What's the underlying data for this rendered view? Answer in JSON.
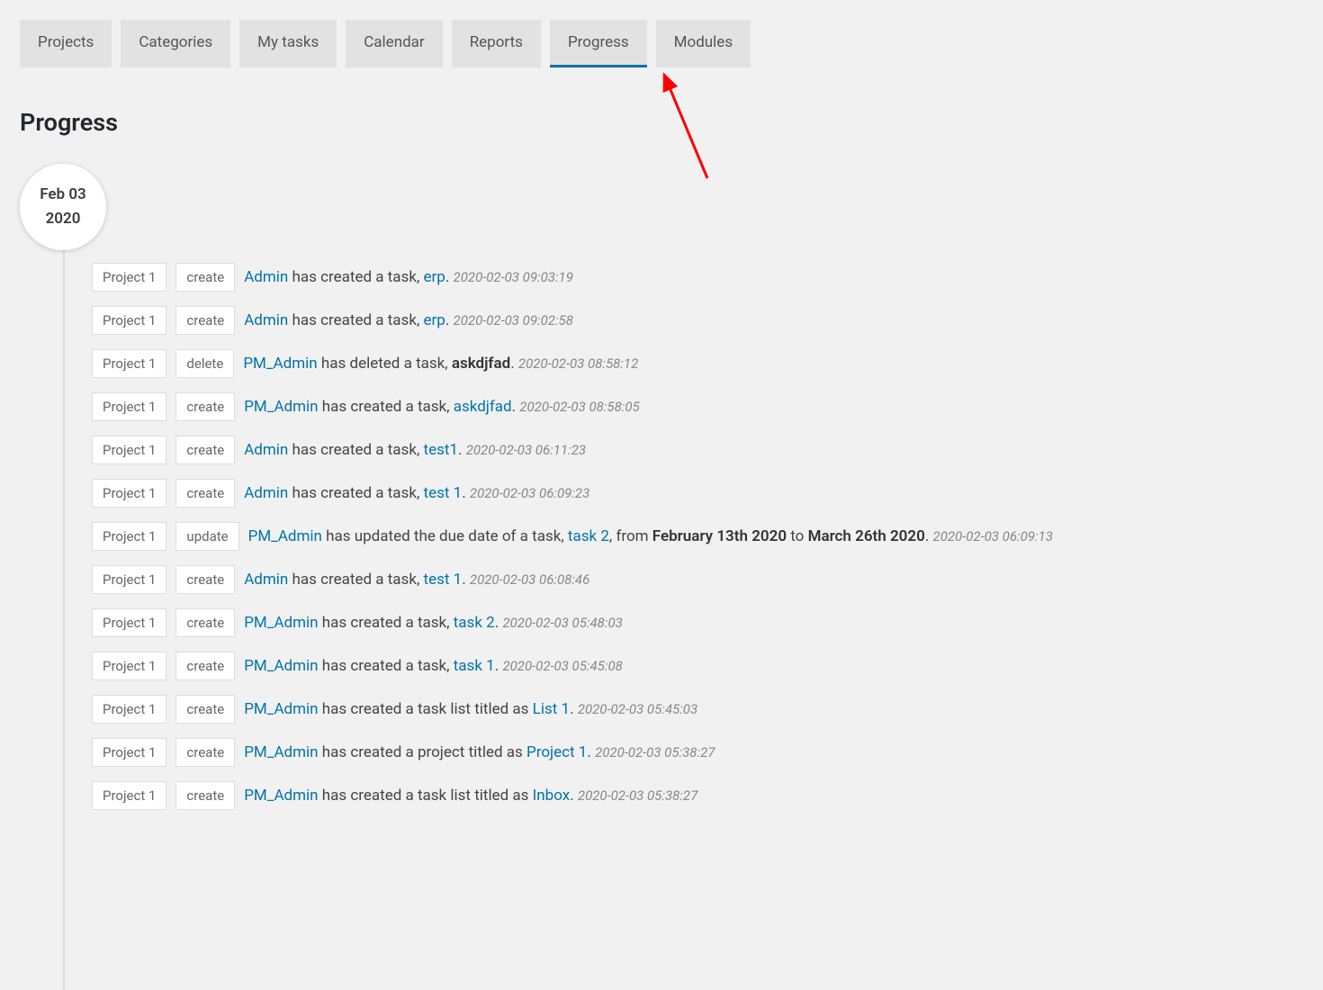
{
  "tabs": [
    {
      "label": "Projects",
      "active": false
    },
    {
      "label": "Categories",
      "active": false
    },
    {
      "label": "My tasks",
      "active": false
    },
    {
      "label": "Calendar",
      "active": false
    },
    {
      "label": "Reports",
      "active": false
    },
    {
      "label": "Progress",
      "active": true
    },
    {
      "label": "Modules",
      "active": false
    }
  ],
  "page_title": "Progress",
  "date_badge": {
    "line1": "Feb 03",
    "line2": "2020"
  },
  "activities": [
    {
      "project": "Project 1",
      "action": "create",
      "user": "Admin",
      "middle": "has created a task,",
      "object": "erp",
      "suffix": ".",
      "timestamp": "2020-02-03 09:03:19"
    },
    {
      "project": "Project 1",
      "action": "create",
      "user": "Admin",
      "middle": "has created a task,",
      "object": "erp",
      "suffix": ".",
      "timestamp": "2020-02-03 09:02:58"
    },
    {
      "project": "Project 1",
      "action": "delete",
      "user": "PM_Admin",
      "middle": "has deleted a task,",
      "object_bold": "askdjfad",
      "suffix": ".",
      "timestamp": "2020-02-03 08:58:12"
    },
    {
      "project": "Project 1",
      "action": "create",
      "user": "PM_Admin",
      "middle": "has created a task,",
      "object": "askdjfad",
      "suffix": ".",
      "timestamp": "2020-02-03 08:58:05"
    },
    {
      "project": "Project 1",
      "action": "create",
      "user": "Admin",
      "middle": "has created a task,",
      "object": "test1",
      "suffix": ".",
      "timestamp": "2020-02-03 06:11:23"
    },
    {
      "project": "Project 1",
      "action": "create",
      "user": "Admin",
      "middle": "has created a task,",
      "object": "test 1",
      "suffix": ".",
      "timestamp": "2020-02-03 06:09:23"
    },
    {
      "project": "Project 1",
      "action": "update",
      "user": "PM_Admin",
      "middle": "has updated the due date of a task,",
      "object": "task 2",
      "suffix": ", from ",
      "bold1": "February 13th 2020",
      "mid2": " to ",
      "bold2": "March 26th 2020",
      "suffix2": ".",
      "timestamp": "2020-02-03 06:09:13"
    },
    {
      "project": "Project 1",
      "action": "create",
      "user": "Admin",
      "middle": "has created a task,",
      "object": "test 1",
      "suffix": ".",
      "timestamp": "2020-02-03 06:08:46"
    },
    {
      "project": "Project 1",
      "action": "create",
      "user": "PM_Admin",
      "middle": "has created a task,",
      "object": "task 2",
      "suffix": ".",
      "timestamp": "2020-02-03 05:48:03"
    },
    {
      "project": "Project 1",
      "action": "create",
      "user": "PM_Admin",
      "middle": "has created a task,",
      "object": "task 1",
      "suffix": ".",
      "timestamp": "2020-02-03 05:45:08"
    },
    {
      "project": "Project 1",
      "action": "create",
      "user": "PM_Admin",
      "middle": "has created a task list titled as",
      "object": "List 1",
      "suffix": ".",
      "timestamp": "2020-02-03 05:45:03"
    },
    {
      "project": "Project 1",
      "action": "create",
      "user": "PM_Admin",
      "middle": "has created a project titled as",
      "object": "Project 1",
      "suffix": ".",
      "timestamp": "2020-02-03 05:38:27"
    },
    {
      "project": "Project 1",
      "action": "create",
      "user": "PM_Admin",
      "middle": "has created a task list titled as",
      "object": "Inbox",
      "suffix": ".",
      "timestamp": "2020-02-03 05:38:27"
    }
  ]
}
